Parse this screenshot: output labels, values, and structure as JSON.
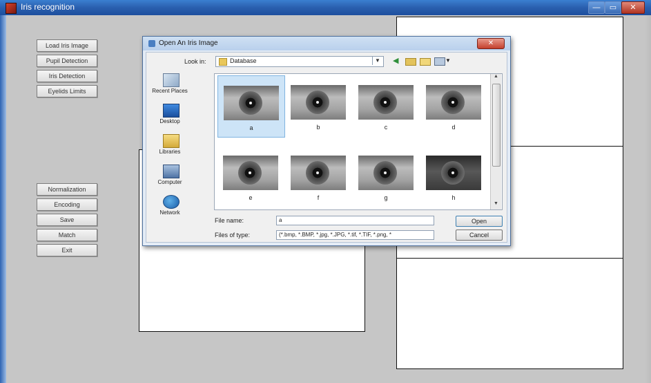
{
  "window": {
    "title": "Iris recognition",
    "min_label": "—",
    "max_label": "▭",
    "close_label": "✕"
  },
  "left_panel": {
    "buttons": [
      "Load Iris Image",
      "Pupil Detection",
      "Iris Detection",
      "Eyelids Limits",
      "Normalization",
      "Encoding",
      "Save",
      "Match",
      "Exit"
    ]
  },
  "dialog": {
    "title": "Open An Iris Image",
    "close_label": "✕",
    "look_in_label": "Look in:",
    "look_in_value": "Database",
    "places": [
      "Recent Places",
      "Desktop",
      "Libraries",
      "Computer",
      "Network"
    ],
    "files": [
      "a",
      "b",
      "c",
      "d",
      "e",
      "f",
      "g",
      "h"
    ],
    "selected_file": "a",
    "file_name_label": "File name:",
    "file_name_value": "a",
    "files_of_type_label": "Files of type:",
    "files_of_type_value": "(*.bmp, *.BMP, *.jpg, *.JPG, *.tif, *.TIF, *.png, *",
    "open_label": "Open",
    "cancel_label": "Cancel",
    "icons": {
      "back": "back-arrow-icon",
      "up": "up-folder-icon",
      "new_folder": "new-folder-icon",
      "views": "views-menu-icon"
    }
  },
  "colors": {
    "titlebar": "#2a5fae",
    "figure_background": "#c6c6c6",
    "selection": "#cde4f7"
  }
}
